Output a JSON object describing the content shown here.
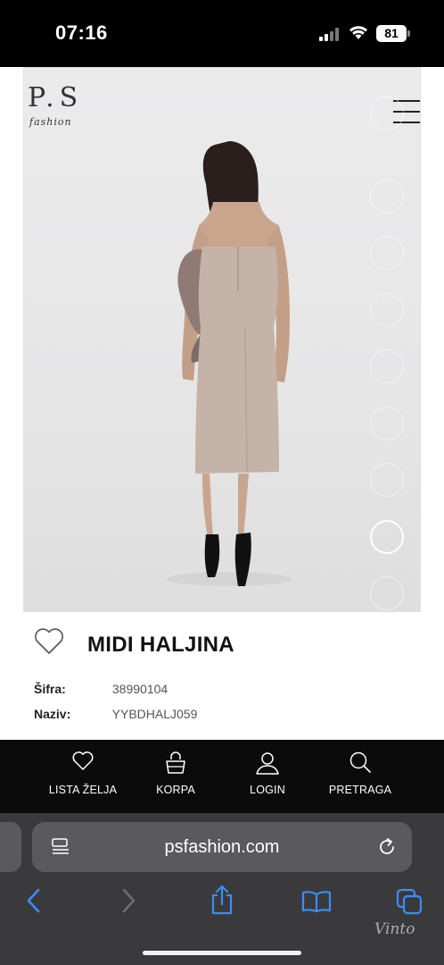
{
  "status_bar": {
    "time": "07:16",
    "battery": "81"
  },
  "site": {
    "logo_text": "P.S",
    "logo_sub": "fashion"
  },
  "carousel": {
    "slide_count": 9,
    "active_index": 7
  },
  "product": {
    "title": "MIDI HALJINA",
    "specs": [
      {
        "label": "Šifra:",
        "value": "38990104"
      },
      {
        "label": "Naziv:",
        "value": "YYBDHALJ059"
      }
    ]
  },
  "bottom_nav": [
    {
      "label": "LISTA ŽELJA",
      "icon": "heart-icon"
    },
    {
      "label": "KORPA",
      "icon": "bag-icon"
    },
    {
      "label": "LOGIN",
      "icon": "user-icon"
    },
    {
      "label": "PRETRAGA",
      "icon": "search-icon"
    }
  ],
  "browser": {
    "url": "psfashion.com"
  },
  "watermark": "Vinto"
}
